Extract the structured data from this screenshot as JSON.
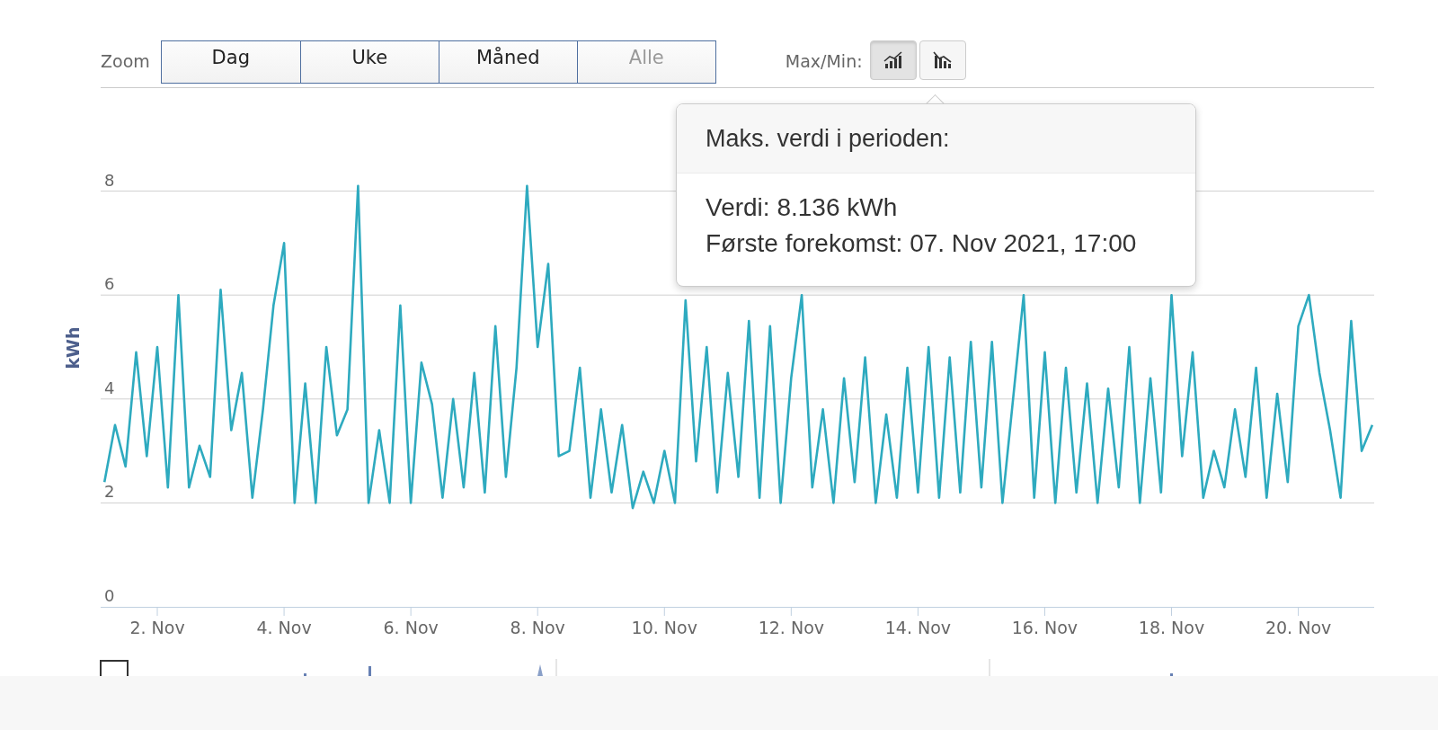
{
  "toolbar": {
    "zoom_label": "Zoom",
    "zoom_buttons": [
      {
        "label": "Dag",
        "selected": false,
        "disabled": false
      },
      {
        "label": "Uke",
        "selected": false,
        "disabled": false
      },
      {
        "label": "Måned",
        "selected": false,
        "disabled": false
      },
      {
        "label": "Alle",
        "selected": false,
        "disabled": true
      }
    ],
    "maxmin_label": "Max/Min:",
    "maxmin_buttons": [
      {
        "kind": "max",
        "selected": true
      },
      {
        "kind": "min",
        "selected": false
      }
    ]
  },
  "tooltip": {
    "title": "Maks. verdi i perioden:",
    "lines": [
      "Verdi: 8.136 kWh",
      "Første forekomst: 07. Nov 2021, 17:00"
    ]
  },
  "chart_data": {
    "type": "line",
    "grid": true,
    "ylabel": "kWh",
    "ylim": [
      0,
      10
    ],
    "yticks": [
      0,
      2,
      4,
      6,
      8
    ],
    "categories": [
      null,
      null,
      null,
      null,
      null,
      "2. Nov",
      null,
      null,
      null,
      null,
      null,
      null,
      null,
      null,
      null,
      null,
      null,
      "4. Nov",
      null,
      null,
      null,
      null,
      null,
      null,
      null,
      null,
      null,
      null,
      null,
      "6. Nov",
      null,
      null,
      null,
      null,
      null,
      null,
      null,
      null,
      null,
      null,
      null,
      "8. Nov",
      null,
      null,
      null,
      null,
      null,
      null,
      null,
      null,
      null,
      null,
      null,
      "10. Nov",
      null,
      null,
      null,
      null,
      null,
      null,
      null,
      null,
      null,
      null,
      null,
      "12. Nov",
      null,
      null,
      null,
      null,
      null,
      null,
      null,
      null,
      null,
      null,
      null,
      "14. Nov",
      null,
      null,
      null,
      null,
      null,
      null,
      null,
      null,
      null,
      null,
      null,
      "16. Nov",
      null,
      null,
      null,
      null,
      null,
      null,
      null,
      null,
      null,
      null,
      null,
      "18. Nov",
      null,
      null,
      null,
      null,
      null,
      null,
      null,
      null,
      null,
      null,
      null,
      "20. Nov",
      null,
      null,
      null,
      null,
      null,
      null,
      null
    ],
    "series": [
      {
        "color": "#2eaabf",
        "values": [
          2.4,
          3.5,
          2.7,
          4.9,
          2.9,
          5.0,
          2.3,
          6.0,
          2.3,
          3.1,
          2.5,
          6.1,
          3.4,
          4.5,
          2.1,
          3.8,
          5.8,
          7.0,
          2.0,
          4.3,
          2.0,
          5.0,
          3.3,
          3.8,
          8.1,
          2.0,
          3.4,
          2.0,
          5.8,
          2.0,
          4.7,
          3.9,
          2.1,
          4.0,
          2.3,
          4.5,
          2.2,
          5.4,
          2.5,
          4.6,
          8.1,
          5.0,
          6.6,
          2.9,
          3.0,
          4.6,
          2.1,
          3.8,
          2.2,
          3.5,
          1.9,
          2.6,
          2.0,
          3.0,
          2.0,
          5.9,
          2.8,
          5.0,
          2.2,
          4.5,
          2.5,
          5.5,
          2.1,
          5.4,
          2.0,
          4.4,
          6.0,
          2.3,
          3.8,
          2.0,
          4.4,
          2.4,
          4.8,
          2.0,
          3.7,
          2.1,
          4.6,
          2.2,
          5.0,
          2.1,
          4.8,
          2.2,
          5.1,
          2.3,
          5.1,
          2.0,
          4.0,
          6.0,
          2.1,
          4.9,
          2.0,
          4.6,
          2.2,
          4.3,
          2.0,
          4.2,
          2.3,
          5.0,
          2.0,
          4.4,
          2.2,
          6.0,
          2.9,
          4.9,
          2.1,
          3.0,
          2.3,
          3.8,
          2.5,
          4.6,
          2.1,
          4.1,
          2.4,
          5.4,
          6.0,
          4.5,
          3.4,
          2.1,
          5.5,
          3.0,
          3.5
        ]
      }
    ]
  }
}
